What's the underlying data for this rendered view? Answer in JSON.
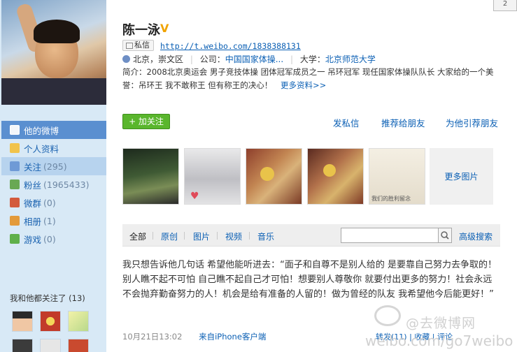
{
  "profile": {
    "name": "陈一泳",
    "message_button": "私信",
    "url": "http://t.weibo.com/1838388131",
    "location": "北京，崇文区",
    "company_label": "公司：",
    "company": "中国国家体操...",
    "school_label": "大学：",
    "school": "北京师范大学",
    "bio": "简介：2008北京奥运会 男子竞技体操 团体冠军成员之一 吊环冠军 现任国家体操队队长 大家给的一个美誉：吊环王 我不敢称王 但有称王的决心！",
    "more_link": "更多资料>>"
  },
  "actions": {
    "follow": "+ 加关注",
    "send_msg": "发私信",
    "recommend": "推荐给朋友",
    "recommend_him": "为他引荐朋友"
  },
  "nav": [
    {
      "label": "他的微博",
      "count": ""
    },
    {
      "label": "个人资料",
      "count": ""
    },
    {
      "label": "关注",
      "count": "(295)"
    },
    {
      "label": "粉丝",
      "count": "(1965433)"
    },
    {
      "label": "微群",
      "count": "(0)"
    },
    {
      "label": "相册",
      "count": "(1)"
    },
    {
      "label": "游戏",
      "count": "(0)"
    }
  ],
  "mutual": {
    "label": "我和他都关注了",
    "count": "(13)"
  },
  "photos": {
    "more": "更多图片",
    "caption": "我们的胜利留念"
  },
  "tabs": {
    "all": "全部",
    "original": "原创",
    "pictures": "图片",
    "video": "视频",
    "music": "音乐",
    "search_placeholder": "",
    "advanced": "高级搜索"
  },
  "post": {
    "text": "我只想告诉他几句话 希望他能听进去：“面子和自尊不是别人给的 是要靠自己努力去争取的！别人瞧不起不可怕 自己瞧不起自己才可怕！想要别人尊敬你 就要付出更多的努力！社会永远不会抛弃勤奋努力的人！机会是给有准备的人留的！做为曾经的队友 我希望他今后能更好！”",
    "time": "10月21日13:02",
    "source": "来自iPhone客户端",
    "ops": "转发(11)  |  收藏  |  评论"
  },
  "corner": "2",
  "watermark": {
    "line1": "@去微博网",
    "line2": "weibo.com/go7weibo"
  }
}
